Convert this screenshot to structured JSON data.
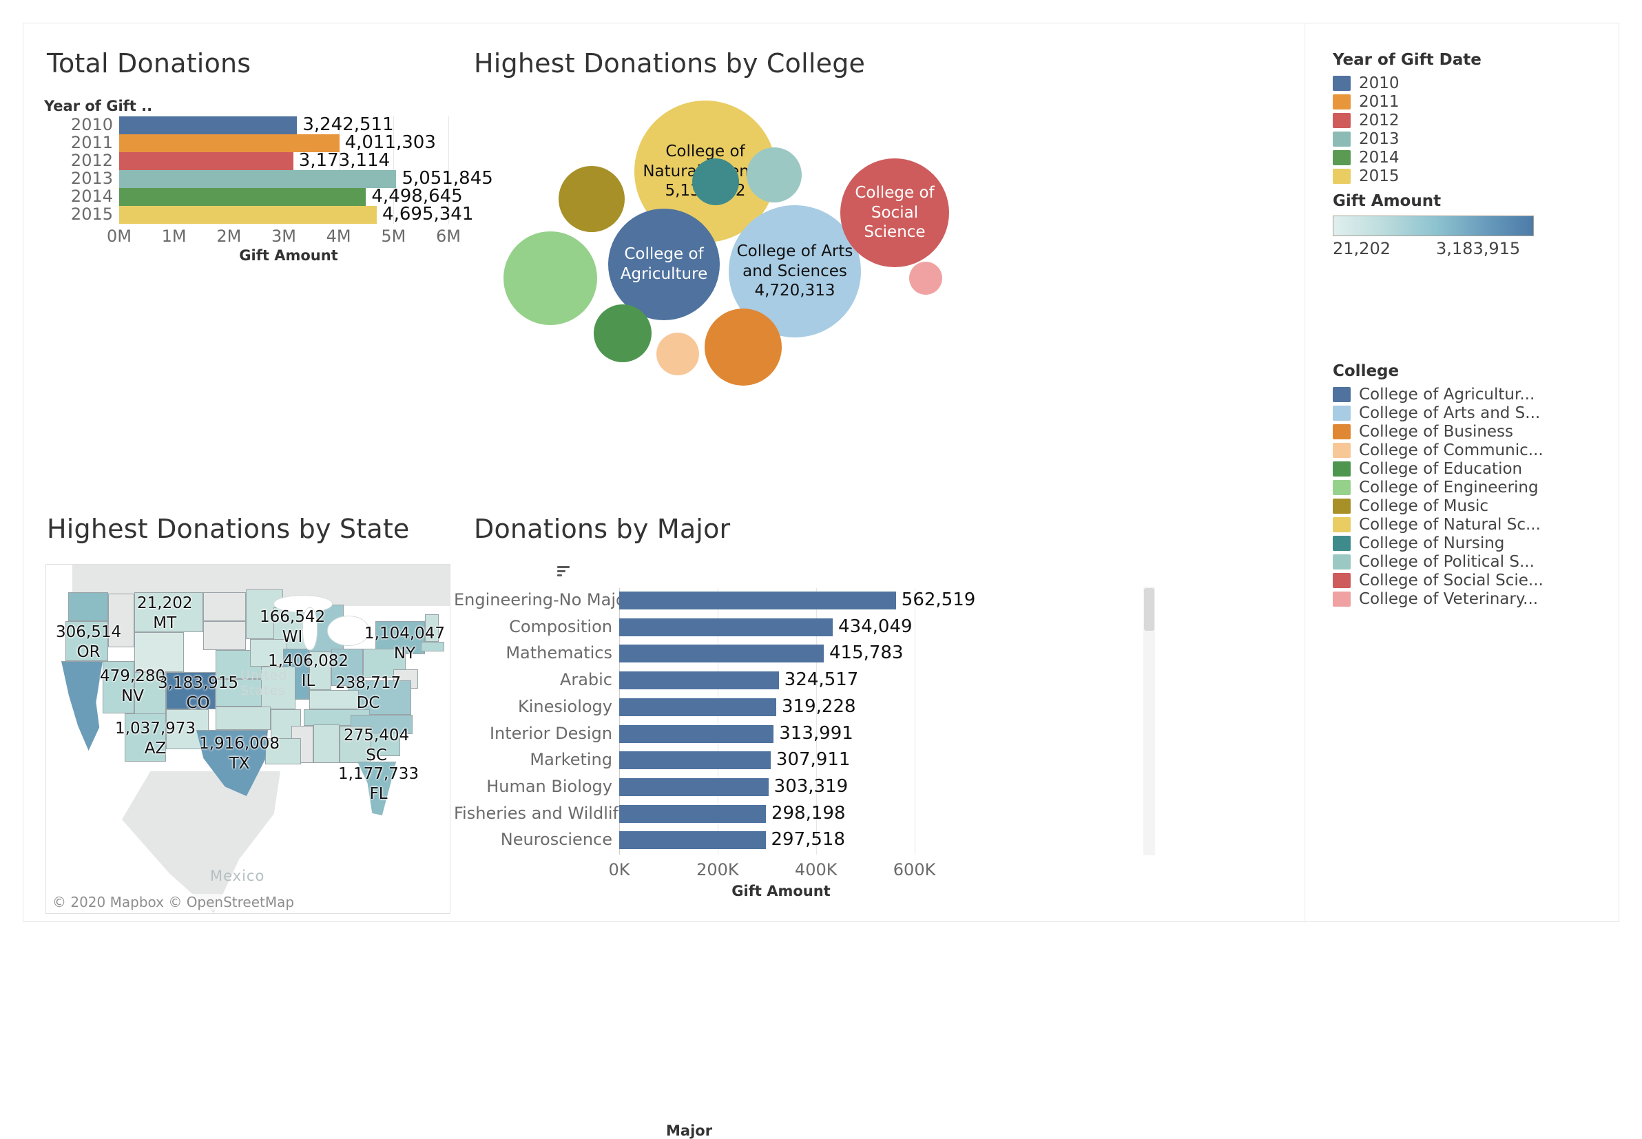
{
  "panels": {
    "total_donations": {
      "title": "Total Donations",
      "field_caption": "Year of Gift ..",
      "axis_title": "Gift Amount"
    },
    "highest_by_college": {
      "title": "Highest Donations by College"
    },
    "highest_by_state": {
      "title": "Highest Donations by State",
      "attribution": "© 2020 Mapbox  © OpenStreetMap",
      "watermark_line1": "United",
      "watermark_line2": "States",
      "watermark_mexico": "Mexico"
    },
    "donations_by_major": {
      "title": "Donations by Major",
      "field_caption": "Major",
      "sort_icon": "sort-descending-icon",
      "axis_title": "Gift Amount"
    }
  },
  "legend": {
    "year_header": "Year of Gift Date",
    "years": [
      {
        "label": "2010",
        "color": "#4f729f"
      },
      {
        "label": "2011",
        "color": "#e8963c"
      },
      {
        "label": "2012",
        "color": "#d05b5b"
      },
      {
        "label": "2013",
        "color": "#8cbbb6"
      },
      {
        "label": "2014",
        "color": "#5a9a53"
      },
      {
        "label": "2015",
        "color": "#e9cd63"
      }
    ],
    "gift_amount_header": "Gift Amount",
    "gift_amount_min": "21,202",
    "gift_amount_max": "3,183,915",
    "college_header": "College",
    "colleges": [
      {
        "label": "College of Agricultur...",
        "color": "#4f729f"
      },
      {
        "label": "College of Arts and S...",
        "color": "#a8cce4"
      },
      {
        "label": "College of Business",
        "color": "#e08734"
      },
      {
        "label": "College of Communic...",
        "color": "#f8c798"
      },
      {
        "label": "College of Education",
        "color": "#4e9650"
      },
      {
        "label": "College of Engineering",
        "color": "#96d18b"
      },
      {
        "label": "College of Music",
        "color": "#a69027"
      },
      {
        "label": "College of Natural Sc...",
        "color": "#e9cd63"
      },
      {
        "label": "College of Nursing",
        "color": "#3f8b8b"
      },
      {
        "label": "College of Political S...",
        "color": "#9cc8c3"
      },
      {
        "label": "College of Social Scie...",
        "color": "#ce5c5c"
      },
      {
        "label": "College of Veterinary...",
        "color": "#f0a2a2"
      }
    ]
  },
  "chart_data": [
    {
      "type": "bar",
      "orientation": "horizontal",
      "title": "Total Donations",
      "xlabel": "Gift Amount",
      "ylabel": "Year of Gift ..",
      "xlim": [
        0,
        6000000
      ],
      "grid": true,
      "xticks": [
        "0M",
        "1M",
        "2M",
        "3M",
        "4M",
        "5M",
        "6M"
      ],
      "xtick_values": [
        0,
        1000000,
        2000000,
        3000000,
        4000000,
        5000000,
        6000000
      ],
      "categories": [
        "2010",
        "2011",
        "2012",
        "2013",
        "2014",
        "2015"
      ],
      "values": [
        3242511,
        4011303,
        3173114,
        5051845,
        4498645,
        4695341
      ],
      "labels": [
        "3,242,511",
        "4,011,303",
        "3,173,114",
        "5,051,845",
        "4,498,645",
        "4,695,341"
      ],
      "colors": [
        "#4f729f",
        "#e8963c",
        "#d05b5b",
        "#8cbbb6",
        "#5a9a53",
        "#e9cd63"
      ]
    },
    {
      "type": "bubble",
      "title": "Highest Donations by College",
      "bubbles": [
        {
          "name": "College of Natural Science",
          "value": 5136972,
          "label": "5,136,972",
          "color": "#e9cd63",
          "cx": 370,
          "cy": 140,
          "r": 103,
          "text": "dark",
          "show_name": true,
          "show_value": true
        },
        {
          "name": "College of Arts and Sciences",
          "value": 4720313,
          "label": "4,720,313",
          "color": "#a8cce4",
          "cx": 500,
          "cy": 285,
          "r": 96,
          "text": "dark",
          "show_name": true,
          "show_value": true
        },
        {
          "name": "College of Agriculture",
          "value": 0,
          "label": "",
          "color": "#4f729f",
          "cx": 310,
          "cy": 275,
          "r": 81,
          "text": "light",
          "show_name": true,
          "show_value": false
        },
        {
          "name": "College of Social Science",
          "value": 0,
          "label": "",
          "color": "#ce5c5c",
          "cx": 645,
          "cy": 200,
          "r": 79,
          "text": "light",
          "show_name": true,
          "show_value": false
        },
        {
          "name": "College of Engineering",
          "value": 0,
          "label": "",
          "color": "#96d18b",
          "cx": 145,
          "cy": 295,
          "r": 68,
          "text": "dark",
          "show_name": false,
          "show_value": false
        },
        {
          "name": "College of Business",
          "value": 0,
          "label": "",
          "color": "#e08734",
          "cx": 425,
          "cy": 395,
          "r": 56,
          "text": "dark",
          "show_name": false,
          "show_value": false
        },
        {
          "name": "College of Music",
          "value": 0,
          "label": "",
          "color": "#a69027",
          "cx": 205,
          "cy": 180,
          "r": 48,
          "text": "dark",
          "show_name": false,
          "show_value": false
        },
        {
          "name": "College of Education",
          "value": 0,
          "label": "",
          "color": "#4e9650",
          "cx": 250,
          "cy": 375,
          "r": 42,
          "text": "dark",
          "show_name": false,
          "show_value": false
        },
        {
          "name": "College of Political Science",
          "value": 0,
          "label": "",
          "color": "#9cc8c3",
          "cx": 470,
          "cy": 145,
          "r": 40,
          "text": "dark",
          "show_name": false,
          "show_value": false
        },
        {
          "name": "College of Nursing",
          "value": 0,
          "label": "",
          "color": "#3f8b8b",
          "cx": 385,
          "cy": 155,
          "r": 34,
          "text": "dark",
          "show_name": false,
          "show_value": false
        },
        {
          "name": "College of Communication",
          "value": 0,
          "label": "",
          "color": "#f8c798",
          "cx": 330,
          "cy": 405,
          "r": 31,
          "text": "dark",
          "show_name": false,
          "show_value": false
        },
        {
          "name": "College of Veterinary Medicine",
          "value": 0,
          "label": "",
          "color": "#f0a2a2",
          "cx": 690,
          "cy": 295,
          "r": 24,
          "text": "dark",
          "show_name": false,
          "show_value": false
        }
      ]
    },
    {
      "type": "heatmap",
      "subtype": "choropleth-map",
      "title": "Highest Donations by State",
      "color_scale_min": 21202,
      "color_scale_max": 3183915,
      "labeled_states": [
        {
          "state": "MT",
          "value": 21202,
          "label": "21,202"
        },
        {
          "state": "OR",
          "value": 306514,
          "label": "306,514"
        },
        {
          "state": "NV",
          "value": 479280,
          "label": "479,280"
        },
        {
          "state": "CO",
          "value": 3183915,
          "label": "3,183,915"
        },
        {
          "state": "AZ",
          "value": 1037973,
          "label": "1,037,973"
        },
        {
          "state": "TX",
          "value": 1916008,
          "label": "1,916,008"
        },
        {
          "state": "WI",
          "value": 166542,
          "label": "166,542"
        },
        {
          "state": "IL",
          "value": 1406082,
          "label": "1,406,082"
        },
        {
          "state": "NY",
          "value": 1104047,
          "label": "1,104,047"
        },
        {
          "state": "DC",
          "value": 238717,
          "label": "238,717"
        },
        {
          "state": "SC",
          "value": 275404,
          "label": "275,404"
        },
        {
          "state": "FL",
          "value": 1177733,
          "label": "1,177,733"
        }
      ]
    },
    {
      "type": "bar",
      "orientation": "horizontal",
      "title": "Donations by Major",
      "xlabel": "Gift Amount",
      "ylabel": "Major",
      "xlim": [
        0,
        700000
      ],
      "grid": true,
      "xticks": [
        "0K",
        "200K",
        "400K",
        "600K"
      ],
      "xtick_values": [
        0,
        200000,
        400000,
        600000
      ],
      "bar_color": "#4f729f",
      "categories": [
        "Engineering-No Major",
        "Composition",
        "Mathematics",
        "Arabic",
        "Kinesiology",
        "Interior Design",
        "Marketing",
        "Human Biology",
        "Fisheries and Wildlife",
        "Neuroscience"
      ],
      "values": [
        562519,
        434049,
        415783,
        324517,
        319228,
        313991,
        307911,
        303319,
        298198,
        297518
      ],
      "labels": [
        "562,519",
        "434,049",
        "415,783",
        "324,517",
        "319,228",
        "313,991",
        "307,911",
        "303,319",
        "298,198",
        "297,518"
      ]
    }
  ]
}
